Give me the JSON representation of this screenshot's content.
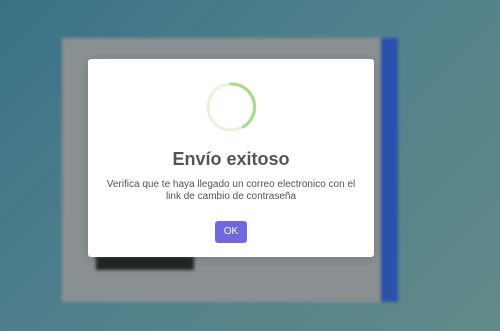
{
  "dialog": {
    "icon": "success-spinner-icon",
    "title": "Envío exitoso",
    "message": "Verifica que te haya llegado un correo electronico con el link de cambio de contraseña",
    "ok_label": "OK"
  },
  "colors": {
    "confirm_button": "#7066e0",
    "success_ring": "#a5dc86",
    "title_text": "#555555"
  }
}
